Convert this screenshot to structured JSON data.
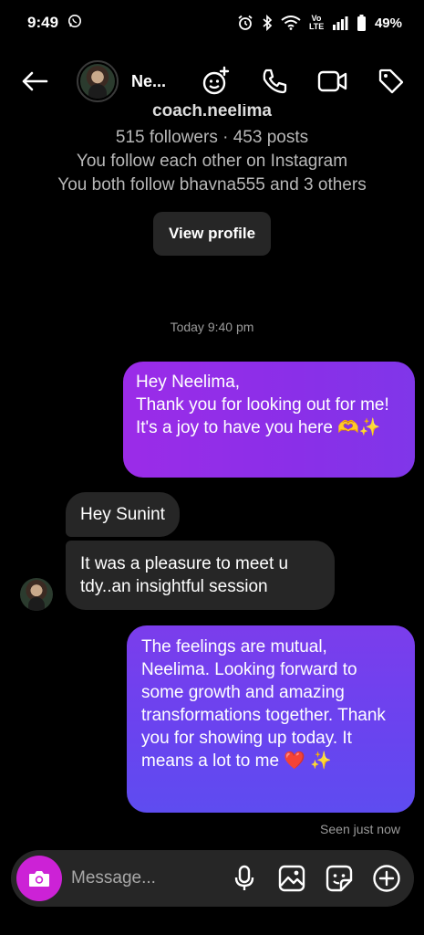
{
  "status_bar": {
    "time": "9:49",
    "battery": "49%",
    "volte": "Vo LTE"
  },
  "header": {
    "contact_name": "Ne...",
    "icons": [
      "back-arrow-icon",
      "avatar",
      "effects-icon",
      "phone-icon",
      "video-icon",
      "tag-icon"
    ]
  },
  "profile": {
    "username": "coach.neelima",
    "stats": "515 followers · 453 posts",
    "mutual_follow": "You follow each other on Instagram",
    "mutual_friends": "You both follow bhavna555 and 3 others",
    "view_profile_label": "View profile"
  },
  "conversation": {
    "timestamp": "Today 9:40 pm",
    "messages": [
      {
        "direction": "out",
        "text": "Hey Neelima,\nThank you for looking out for me! It's a joy to have you here 🫶✨"
      },
      {
        "direction": "in",
        "text": "Hey Sunint"
      },
      {
        "direction": "in",
        "text": "It was a pleasure to meet u tdy..an insightful session"
      },
      {
        "direction": "out",
        "text": "The feelings are mutual, Neelima. Looking forward to some growth and amazing transformations together. Thank you for showing up today. It means a lot to me ❤️ ✨"
      }
    ],
    "seen_status": "Seen just now"
  },
  "composer": {
    "placeholder": "Message...",
    "icons": [
      "camera-icon",
      "microphone-icon",
      "gallery-icon",
      "sticker-icon",
      "plus-icon"
    ]
  },
  "colors": {
    "background": "#000000",
    "incoming_bubble": "#262626",
    "outgoing_bubble_1": "#9b2ce8",
    "outgoing_bubble_2": "#6a43ef",
    "camera_button": "#cc22d6"
  }
}
